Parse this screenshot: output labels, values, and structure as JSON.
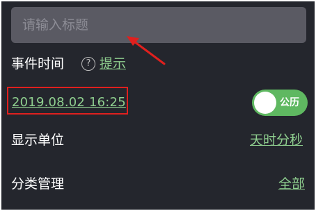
{
  "title_input": {
    "placeholder": "请输入标题",
    "value": ""
  },
  "event_time": {
    "label": "事件时间",
    "hint_link": "提示",
    "help_icon": "question-circle-icon"
  },
  "date_value": "2019.08.02 16:25",
  "calendar_toggle": {
    "label": "公历",
    "on": true
  },
  "display_unit": {
    "label": "显示单位",
    "value": "天时分秒"
  },
  "category": {
    "label": "分类管理",
    "value": "全部"
  },
  "colors": {
    "background": "#24262d",
    "input": "#5a5a63",
    "link": "#8fcf8f",
    "toggle": "#5fb861",
    "annotation": "#e0201e"
  }
}
